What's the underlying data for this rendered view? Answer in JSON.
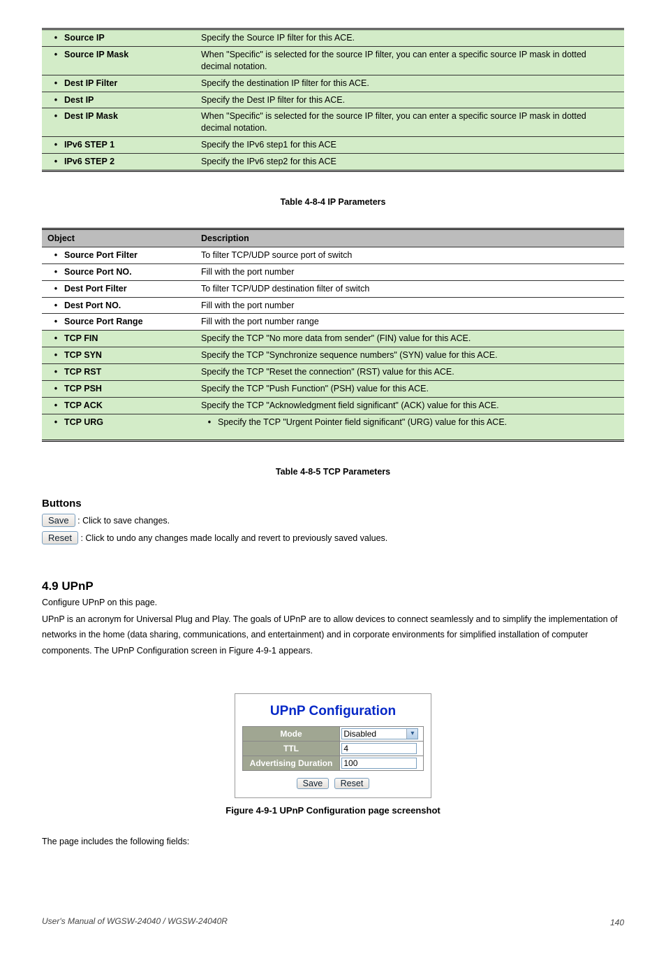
{
  "tableA": {
    "rows": [
      {
        "c1": "Source IP",
        "c2": "Specify the Source IP filter for this ACE."
      },
      {
        "c1": "Source IP Mask",
        "c2": "When \"Specific\" is selected for the source IP filter, you can enter a specific source IP mask in dotted decimal notation."
      },
      {
        "c1": "Dest IP Filter",
        "c2": "Specify the destination IP filter for this ACE."
      },
      {
        "c1": "Dest IP",
        "c2": "Specify the Dest IP filter for this ACE."
      },
      {
        "c1": "Dest IP Mask",
        "c2": "When \"Specific\" is selected for the source IP filter, you can enter a specific source IP mask in dotted decimal notation."
      },
      {
        "c1": "IPv6 STEP 1",
        "c2": "Specify the IPv6 step1 for this ACE"
      },
      {
        "c1": "IPv6 STEP 2",
        "c2": "Specify the IPv6 step2 for this ACE"
      }
    ]
  },
  "tableB": {
    "caption": "Table 4-8-4 IP Parameters",
    "headers": [
      "Object",
      "Description"
    ],
    "rows": [
      {
        "c1": "Source Port Filter",
        "c2": "To filter TCP/UDP source port of switch"
      },
      {
        "c1": "Source Port NO.",
        "c2": "Fill with the port number"
      },
      {
        "c1": "Dest Port Filter",
        "c2": "To filter TCP/UDP destination filter of switch"
      },
      {
        "c1": "Dest Port NO.",
        "c2": "Fill with the port number"
      },
      {
        "c1": "Source Port Range",
        "c2": "Fill with the port number range"
      },
      {
        "c1": "TCP FIN",
        "c2": "Specify the TCP \"No more data from sender\" (FIN) value for this ACE."
      },
      {
        "c1": "TCP SYN",
        "c2": "Specify the TCP \"Synchronize sequence numbers\" (SYN) value for this ACE."
      },
      {
        "c1": "TCP RST",
        "c2": "Specify the TCP \"Reset the connection\" (RST) value for this ACE."
      },
      {
        "c1": "TCP PSH",
        "c2": "Specify the TCP \"Push Function\" (PSH) value for this ACE."
      },
      {
        "c1": "TCP ACK",
        "c2": "Specify the TCP \"Acknowledgment field significant\" (ACK) value for this ACE."
      },
      {
        "c1": "TCP URG",
        "c2": "Specify the TCP \"Urgent Pointer field significant\" (URG) value for this ACE."
      }
    ]
  },
  "tableB_caption": "Table 4-8-5 TCP Parameters",
  "buttons_heading": "Buttons",
  "save_sentence_btn": "Save",
  "save_sentence_rest": ": Click to save changes.",
  "reset_sentence_btn": "Reset",
  "reset_sentence_rest": ": Click to undo any changes made locally and revert to previously saved values.",
  "sec_heading": "4.9 UPnP",
  "sec_desc": "Configure UPnP on this page.",
  "sec_upnp_intro": "UPnP is an acronym for Universal Plug and Play. The goals of UPnP are to allow devices to connect seamlessly and to simplify the implementation of networks in the home (data sharing, communications, and entertainment) and in corporate environments for simplified installation of computer components. The UPnP Configuration screen in Figure 4-9-1 appears.",
  "panel": {
    "title": "UPnP Configuration",
    "rows": [
      {
        "label": "Mode",
        "type": "select",
        "value": "Disabled"
      },
      {
        "label": "TTL",
        "type": "input",
        "value": "4"
      },
      {
        "label": "Advertising Duration",
        "type": "input",
        "value": "100"
      }
    ],
    "save": "Save",
    "reset": "Reset"
  },
  "fig_caption": "Figure 4-9-1 UPnP Configuration page screenshot",
  "desc2": "The page includes the following fields:",
  "footer_text": "User's Manual of WGSW-24040 / WGSW-24040R",
  "page_no": "140"
}
